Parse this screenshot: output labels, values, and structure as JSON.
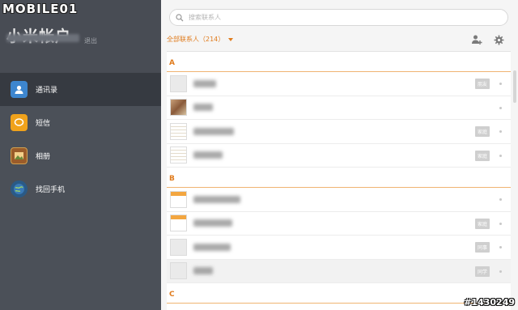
{
  "watermark": "MOBILE01",
  "account": {
    "title": "小米帐户",
    "logout": "退出"
  },
  "nav": [
    {
      "label": "通讯录",
      "icon": "contacts-icon",
      "active": true
    },
    {
      "label": "短信",
      "icon": "sms-icon",
      "active": false
    },
    {
      "label": "相册",
      "icon": "album-icon",
      "active": false
    },
    {
      "label": "找回手机",
      "icon": "find-phone-icon",
      "active": false
    }
  ],
  "search": {
    "placeholder": "搜索联系人"
  },
  "filter": {
    "label": "全部联系人（214）"
  },
  "sections": [
    {
      "letter": "A",
      "rows": [
        {
          "avatar": "default",
          "tag": "朋友"
        },
        {
          "avatar": "photo",
          "tag": ""
        },
        {
          "avatar": "doc",
          "tag": "家庭"
        },
        {
          "avatar": "doc",
          "tag": "家庭"
        }
      ]
    },
    {
      "letter": "B",
      "rows": [
        {
          "avatar": "doc2",
          "tag": ""
        },
        {
          "avatar": "doc2",
          "tag": "家庭"
        },
        {
          "avatar": "default",
          "tag": "同事"
        },
        {
          "avatar": "default",
          "tag": "同学",
          "highlight": true
        }
      ]
    },
    {
      "letter": "C",
      "rows": []
    }
  ],
  "image_id": "#1430249",
  "colors": {
    "accent": "#e07c1e",
    "sidebar": "#4b5058",
    "sidebar_active": "#363a41"
  }
}
